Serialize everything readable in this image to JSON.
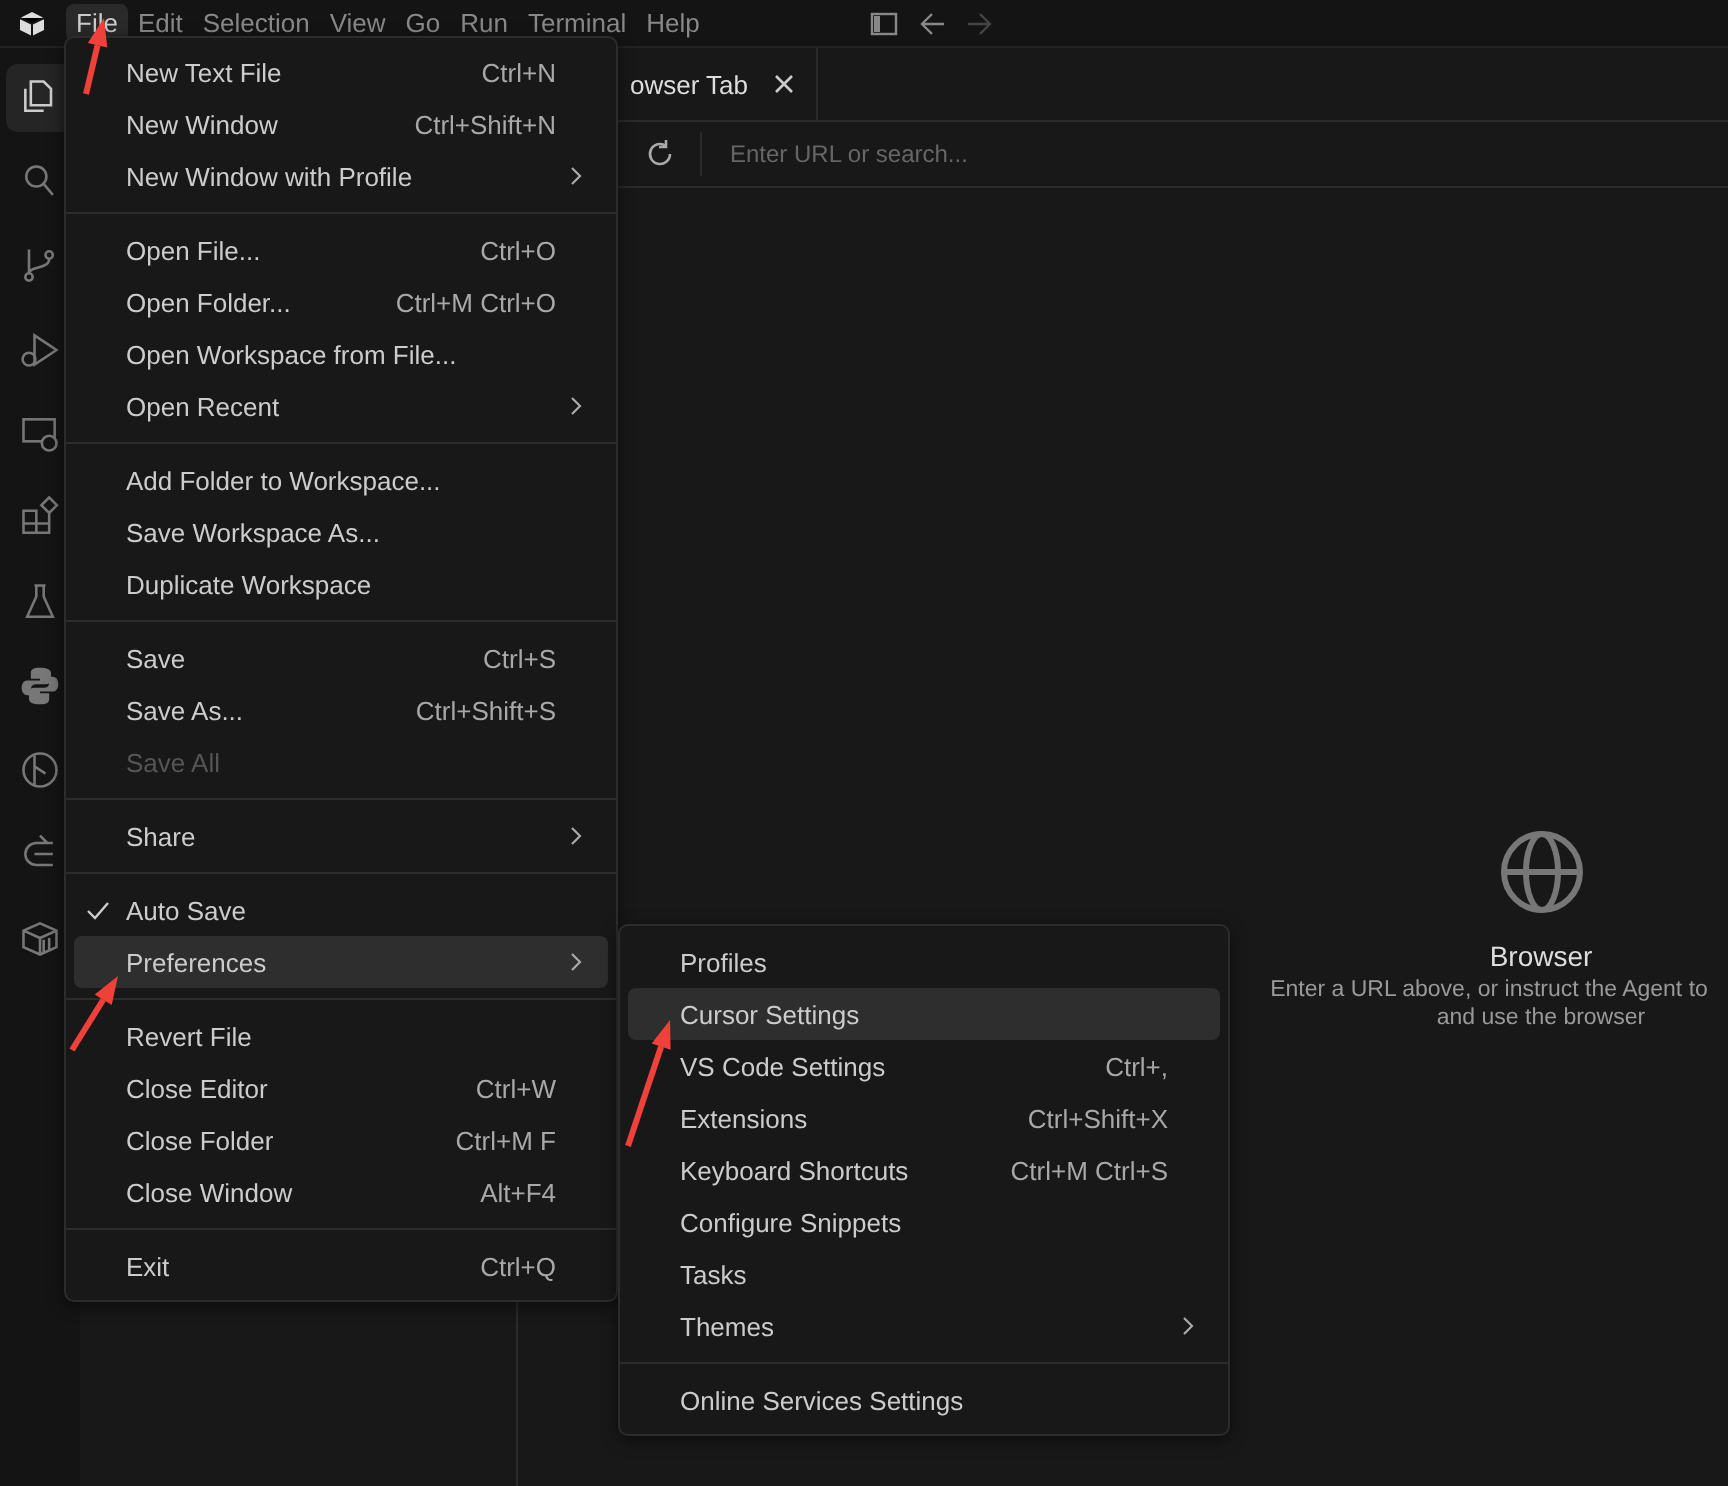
{
  "menubar": [
    {
      "label": "File",
      "selected": true
    },
    {
      "label": "Edit",
      "selected": false
    },
    {
      "label": "Selection",
      "selected": false
    },
    {
      "label": "View",
      "selected": false
    },
    {
      "label": "Go",
      "selected": false
    },
    {
      "label": "Run",
      "selected": false
    },
    {
      "label": "Terminal",
      "selected": false
    },
    {
      "label": "Help",
      "selected": false
    }
  ],
  "activity_bar": [
    {
      "selected": true
    },
    {
      "selected": false
    },
    {
      "selected": false
    },
    {
      "selected": false
    },
    {
      "selected": false
    },
    {
      "selected": false
    },
    {
      "selected": false
    },
    {
      "selected": false
    },
    {
      "selected": false
    },
    {
      "selected": false
    },
    {
      "selected": false
    }
  ],
  "editor": {
    "tab": {
      "label": "owser Tab"
    },
    "url_field": {
      "placeholder": "Enter URL or search..."
    },
    "empty_state": {
      "title": "Browser",
      "lines": [
        "Enter a URL above, or instruct the Agent to",
        "and use the browser"
      ]
    }
  },
  "file_menu": {
    "groups": [
      {
        "items": [
          {
            "label": "New Text File",
            "shortcut": "Ctrl+N",
            "has_submenu": false,
            "checked": false,
            "disabled": false,
            "selected": false
          },
          {
            "label": "New Window",
            "shortcut": "Ctrl+Shift+N",
            "has_submenu": false,
            "checked": false,
            "disabled": false,
            "selected": false
          },
          {
            "label": "New Window with Profile",
            "has_submenu": true,
            "checked": false,
            "disabled": false,
            "selected": false
          }
        ]
      },
      {
        "items": [
          {
            "label": "Open File...",
            "shortcut": "Ctrl+O",
            "has_submenu": false,
            "checked": false,
            "disabled": false,
            "selected": false
          },
          {
            "label": "Open Folder...",
            "shortcut": "Ctrl+M Ctrl+O",
            "has_submenu": false,
            "checked": false,
            "disabled": false,
            "selected": false
          },
          {
            "label": "Open Workspace from File...",
            "has_submenu": false,
            "checked": false,
            "disabled": false,
            "selected": false
          },
          {
            "label": "Open Recent",
            "has_submenu": true,
            "checked": false,
            "disabled": false,
            "selected": false
          }
        ]
      },
      {
        "items": [
          {
            "label": "Add Folder to Workspace...",
            "has_submenu": false,
            "checked": false,
            "disabled": false,
            "selected": false
          },
          {
            "label": "Save Workspace As...",
            "has_submenu": false,
            "checked": false,
            "disabled": false,
            "selected": false
          },
          {
            "label": "Duplicate Workspace",
            "has_submenu": false,
            "checked": false,
            "disabled": false,
            "selected": false
          }
        ]
      },
      {
        "items": [
          {
            "label": "Save",
            "shortcut": "Ctrl+S",
            "has_submenu": false,
            "checked": false,
            "disabled": false,
            "selected": false
          },
          {
            "label": "Save As...",
            "shortcut": "Ctrl+Shift+S",
            "has_submenu": false,
            "checked": false,
            "disabled": false,
            "selected": false
          },
          {
            "label": "Save All",
            "has_submenu": false,
            "checked": false,
            "disabled": true,
            "selected": false
          }
        ]
      },
      {
        "items": [
          {
            "label": "Share",
            "has_submenu": true,
            "checked": false,
            "disabled": false,
            "selected": false
          }
        ]
      },
      {
        "items": [
          {
            "label": "Auto Save",
            "has_submenu": false,
            "checked": true,
            "disabled": false,
            "selected": false
          },
          {
            "label": "Preferences",
            "has_submenu": true,
            "checked": false,
            "disabled": false,
            "selected": true
          }
        ]
      },
      {
        "items": [
          {
            "label": "Revert File",
            "has_submenu": false,
            "checked": false,
            "disabled": false,
            "selected": false
          },
          {
            "label": "Close Editor",
            "shortcut": "Ctrl+W",
            "has_submenu": false,
            "checked": false,
            "disabled": false,
            "selected": false
          },
          {
            "label": "Close Folder",
            "shortcut": "Ctrl+M F",
            "has_submenu": false,
            "checked": false,
            "disabled": false,
            "selected": false
          },
          {
            "label": "Close Window",
            "shortcut": "Alt+F4",
            "has_submenu": false,
            "checked": false,
            "disabled": false,
            "selected": false
          }
        ]
      },
      {
        "items": [
          {
            "label": "Exit",
            "shortcut": "Ctrl+Q",
            "has_submenu": false,
            "checked": false,
            "disabled": false,
            "selected": false
          }
        ]
      }
    ]
  },
  "preferences_menu": {
    "groups": [
      {
        "items": [
          {
            "label": "Profiles",
            "has_submenu": false,
            "checked": false,
            "disabled": false,
            "selected": false
          },
          {
            "label": "Cursor Settings",
            "has_submenu": false,
            "checked": false,
            "disabled": false,
            "selected": true
          },
          {
            "label": "VS Code Settings",
            "shortcut": "Ctrl+,",
            "has_submenu": false,
            "checked": false,
            "disabled": false,
            "selected": false
          },
          {
            "label": "Extensions",
            "shortcut": "Ctrl+Shift+X",
            "has_submenu": false,
            "checked": false,
            "disabled": false,
            "selected": false
          },
          {
            "label": "Keyboard Shortcuts",
            "shortcut": "Ctrl+M Ctrl+S",
            "has_submenu": false,
            "checked": false,
            "disabled": false,
            "selected": false
          },
          {
            "label": "Configure Snippets",
            "has_submenu": false,
            "checked": false,
            "disabled": false,
            "selected": false
          },
          {
            "label": "Tasks",
            "has_submenu": false,
            "checked": false,
            "disabled": false,
            "selected": false
          },
          {
            "label": "Themes",
            "has_submenu": true,
            "checked": false,
            "disabled": false,
            "selected": false
          }
        ]
      },
      {
        "items": [
          {
            "label": "Online Services Settings",
            "has_submenu": false,
            "checked": false,
            "disabled": false,
            "selected": false
          }
        ]
      }
    ]
  }
}
